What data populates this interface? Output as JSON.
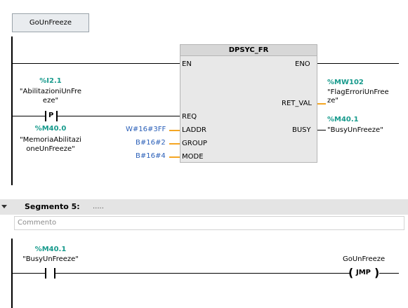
{
  "segment4": {
    "jump_label": "GoUnFreeze",
    "block": {
      "title": "DPSYC_FR",
      "pins_left": {
        "en": "EN",
        "req": "REQ",
        "laddr": "LADDR",
        "group": "GROUP",
        "mode": "MODE"
      },
      "pins_right": {
        "eno": "ENO",
        "ret_val": "RET_VAL",
        "busy": "BUSY"
      },
      "laddr_value": "W#16#3FF",
      "group_value": "B#16#2",
      "mode_value": "B#16#4",
      "ret_val_address": "%MW102",
      "ret_val_symbol_l1": "\"FlagErroriUnFree",
      "ret_val_symbol_l2": "ze\"",
      "busy_address": "%M40.1",
      "busy_symbol": "\"BusyUnFreeze\""
    },
    "contact_enable": {
      "address": "%I2.1",
      "symbol_l1": "\"AbilitazioniUnFre",
      "symbol_l2": "eze\""
    },
    "edge_contact": {
      "type_letter": "P",
      "address": "%M40.0",
      "symbol_l1": "\"MemoriaAbilitazi",
      "symbol_l2": "oneUnFreeze\""
    }
  },
  "segment5": {
    "title": "Segmento 5:",
    "title_dots": ".....",
    "comment_placeholder": "Commento",
    "contact": {
      "address": "%M40.1",
      "symbol": "\"BusyUnFreeze\""
    },
    "jump": {
      "target": "GoUnFreeze",
      "instruction": "JMP"
    }
  }
}
